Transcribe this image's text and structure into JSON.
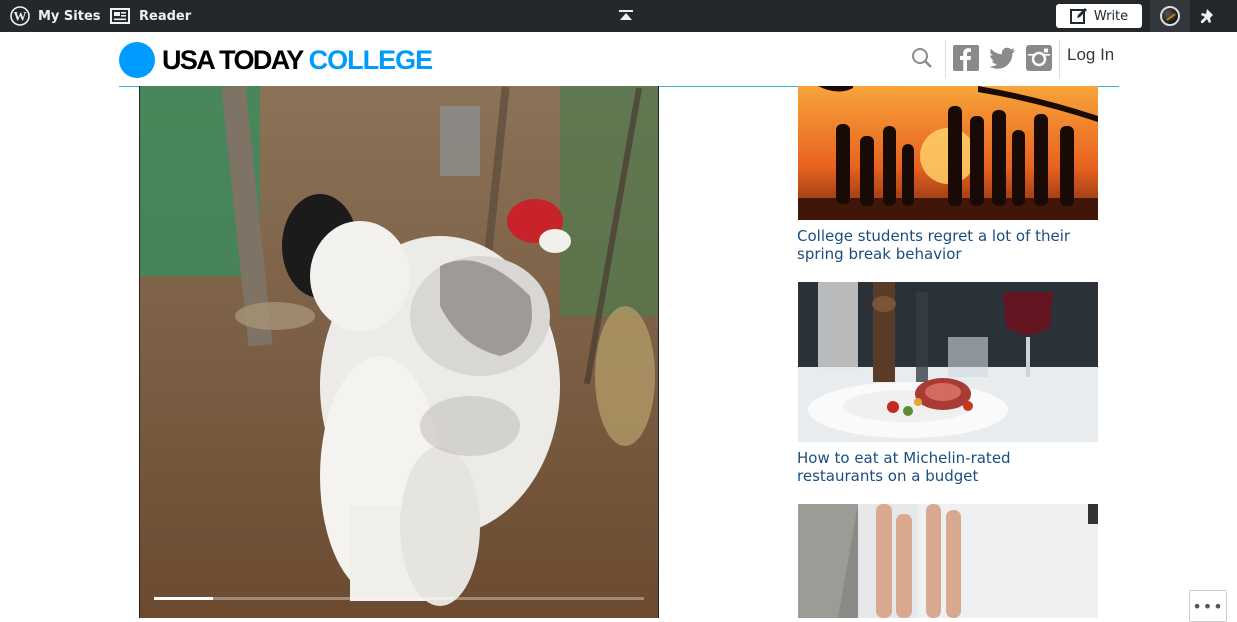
{
  "adminbar": {
    "my_sites": "My Sites",
    "reader": "Reader",
    "write": "Write"
  },
  "header": {
    "logo_part1": "USA TODAY",
    "logo_part2": "COLLEGE",
    "login": "Log In"
  },
  "video": {
    "progress": 0.12
  },
  "sidebar": {
    "articles": [
      {
        "title": "College students regret a lot of their spring break behavior"
      },
      {
        "title": "How to eat at Michelin-rated restaurants on a budget"
      }
    ]
  },
  "colors": {
    "brand_blue": "#009bff",
    "link_blue": "#1a4e7f",
    "adminbar_bg": "#23282d"
  },
  "icons": [
    "wordpress-icon",
    "reader-icon",
    "toggle-bar-icon",
    "write-icon",
    "notifications-icon",
    "search-icon",
    "facebook-icon",
    "twitter-icon",
    "instagram-icon",
    "more-icon"
  ]
}
